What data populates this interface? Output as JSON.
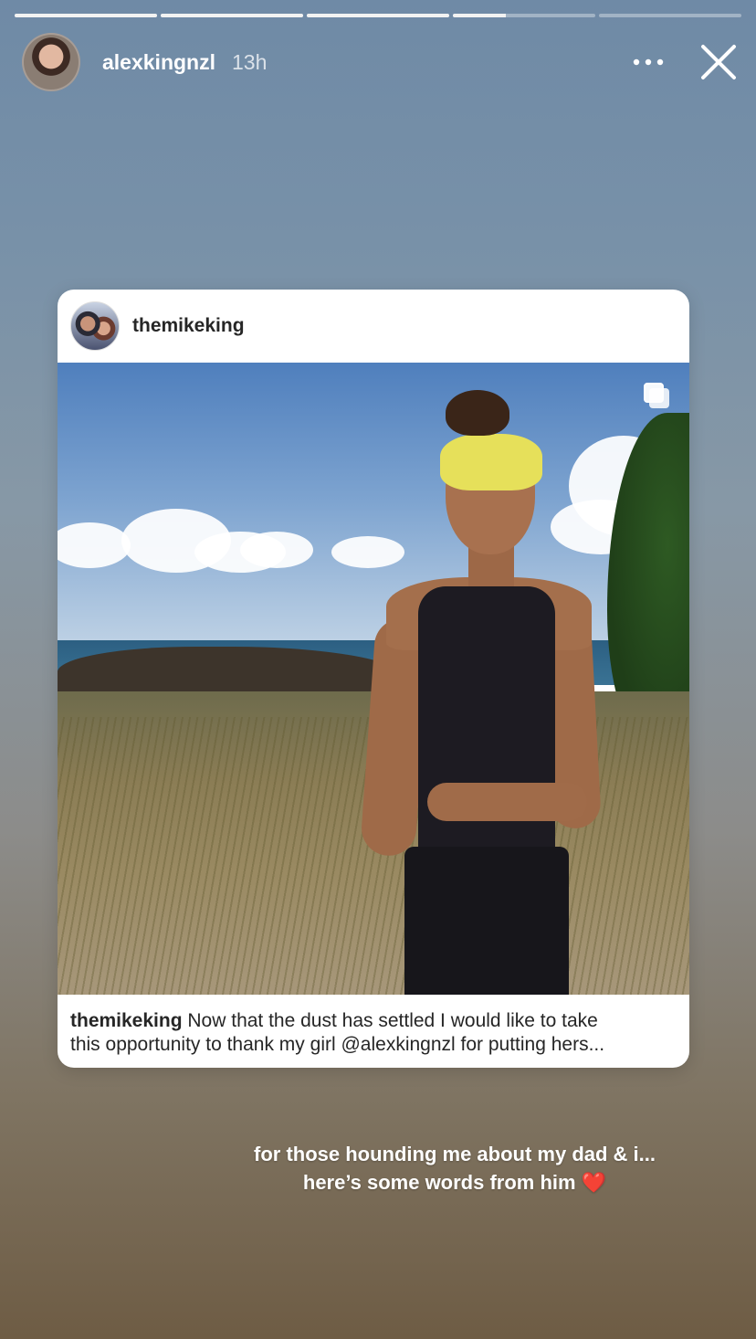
{
  "story": {
    "progress": [
      1,
      1,
      1,
      0.37,
      0
    ],
    "username": "alexkingnzl",
    "time": "13h"
  },
  "post": {
    "username": "themikeking",
    "caption_user": "themikeking",
    "caption_text_line1": "Now that the dust has settled I would like to take",
    "caption_text_line2": "this opportunity to thank my girl @alexkingnzl for putting hers..."
  },
  "overlay_text": {
    "line1": "for those hounding me about my dad & i...",
    "line2": "here’s some words from him",
    "emoji": "❤️"
  },
  "icons": {
    "more": "more-dots-icon",
    "close": "close-icon",
    "multiple": "multiple-photos-icon"
  }
}
